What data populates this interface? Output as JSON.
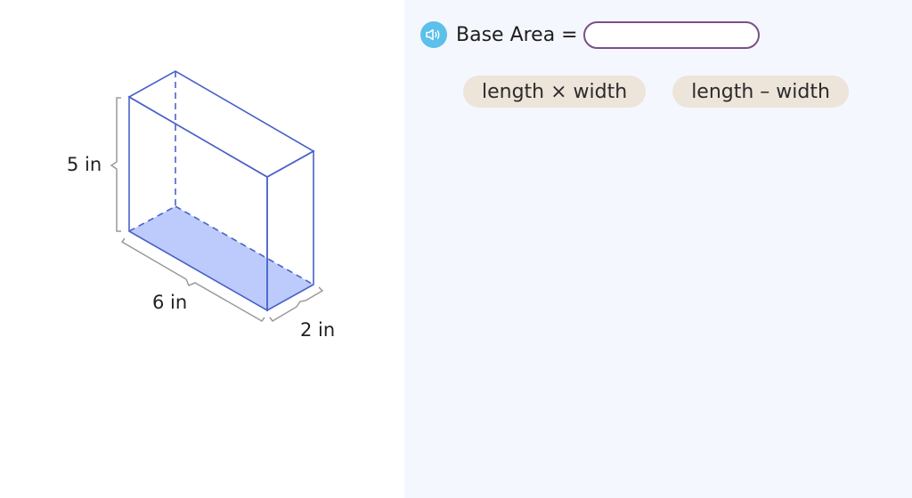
{
  "figure": {
    "height_label": "5 in",
    "length_label": "6 in",
    "width_label": "2 in",
    "edge_color": "#4a62c8",
    "base_fill": "#bccbfb",
    "brace_color": "#9a9a9a"
  },
  "prompt": {
    "speaker_icon": "speaker-icon",
    "label": "Base Area =",
    "answer_value": ""
  },
  "choices": [
    {
      "label": "length × width"
    },
    {
      "label": "length – width"
    }
  ],
  "colors": {
    "right_pane_bg": "#f5f7fe",
    "speaker_bg": "#5bc0ea",
    "answer_border": "#7b4f88",
    "choice_bg": "#ede4da"
  }
}
